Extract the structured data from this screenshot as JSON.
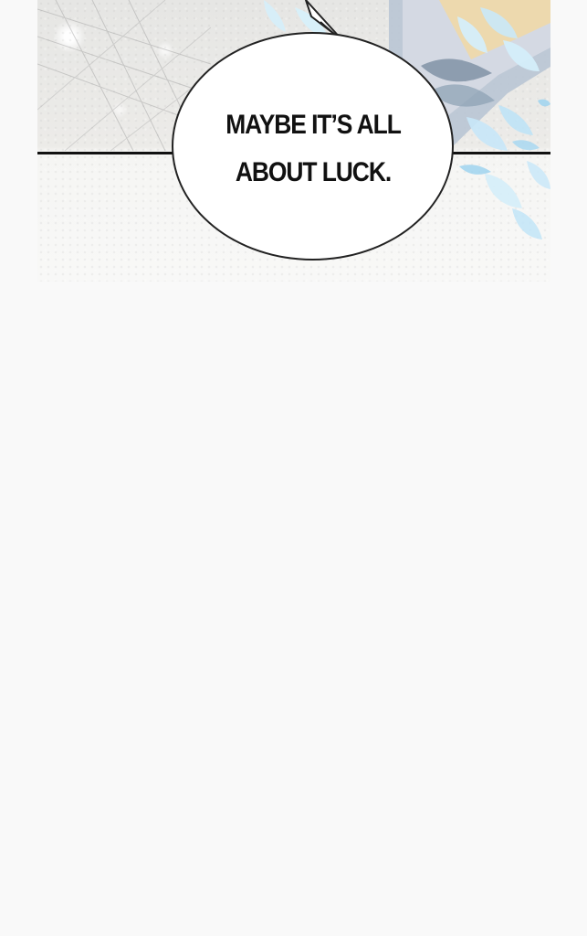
{
  "comic": {
    "speech_text": "MAYBE IT’S ALL ABOUT LUCK."
  }
}
